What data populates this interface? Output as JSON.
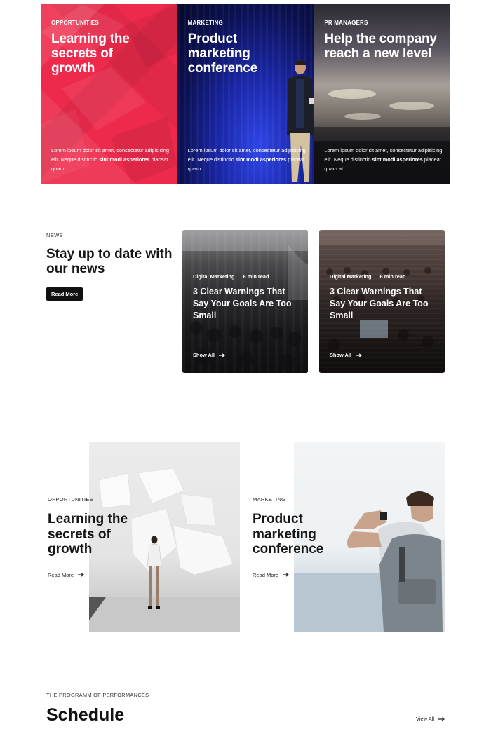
{
  "hero": {
    "cards": [
      {
        "kicker": "OPPORTUNITIES",
        "title": "Learning the secrets of growth",
        "text_plain": "Lorem ipsum dolor sit amet, consectetur adipisicing elit. Neque distinctio ",
        "text_bold1": "sint modi asperiores",
        "text_tail": " placeat quam"
      },
      {
        "kicker": "MARKETING",
        "title": "Product marketing conference",
        "text_plain": "Lorem ipsum dolor sit amet, consectetur adipisicing elit. Neque distinctio ",
        "text_bold1": "sint modi asperiores",
        "text_tail": " placeat quam"
      },
      {
        "kicker": "PR MANAGERS",
        "title": "Help the company reach a new level",
        "text_plain": "Lorem ipsum dolor sit amet, consectetur adipisicing elit. Neque distinctio ",
        "text_bold1": "sint modi asperiores",
        "text_tail": " placeat quam ab"
      }
    ]
  },
  "news": {
    "kicker": "NEWS",
    "title": "Stay up to date with our news",
    "button": "Read More",
    "cards": [
      {
        "category": "Digital Marketing",
        "read_time": "6 min read",
        "title": "3 Clear Warnings That Say Your Goals Are Too Small",
        "link": "Show All"
      },
      {
        "category": "Digital Marketing",
        "read_time": "6 min read",
        "title": "3 Clear Warnings That Say Your Goals Are Too Small",
        "link": "Show All"
      }
    ]
  },
  "features": [
    {
      "kicker": "OPPORTUNITIES",
      "title": "Learning the secrets of growth",
      "link": "Read More"
    },
    {
      "kicker": "MARKETING",
      "title": "Product marketing conference",
      "link": "Read More"
    }
  ],
  "schedule": {
    "kicker": "THE PROGRAMM OF PERFORMANCES",
    "title": "Schedule",
    "view_all": "View All"
  },
  "colors": {
    "hero_red": "#ee2a4c",
    "hero_blue": "#1a27a8",
    "button_dark": "#111111"
  },
  "icons": [
    "arrow-right-icon"
  ]
}
